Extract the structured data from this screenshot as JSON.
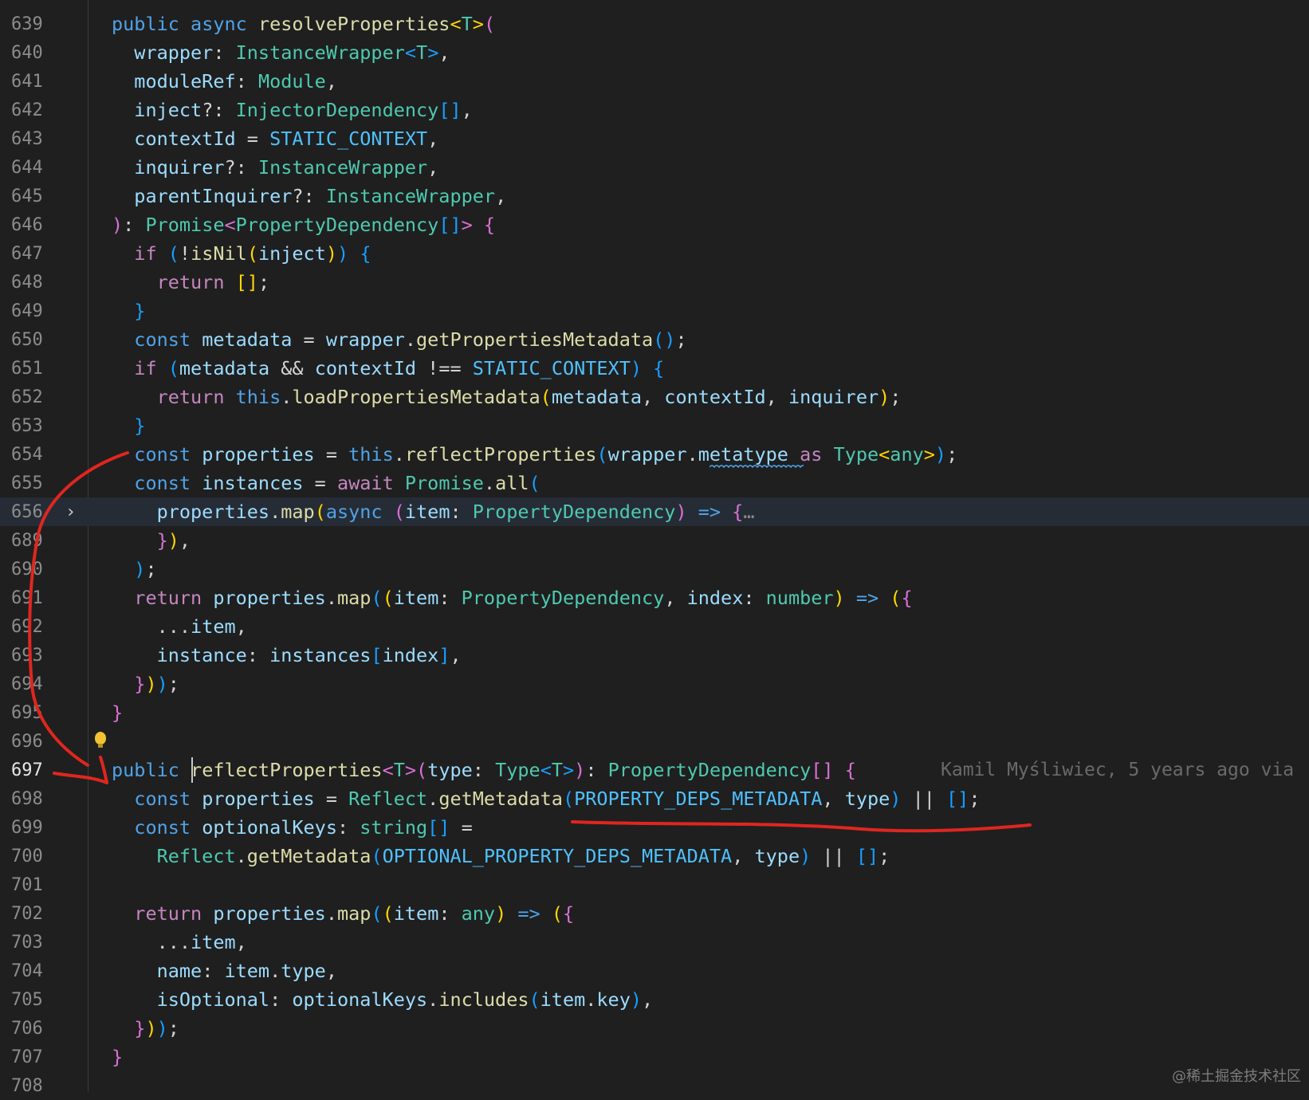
{
  "editor": {
    "lines": [
      {
        "num": "639",
        "tokens": [
          [
            "public ",
            "tok-key"
          ],
          [
            "async ",
            "tok-key"
          ],
          [
            "resolveProperties",
            "tok-fn"
          ],
          [
            "<",
            "tok-b1"
          ],
          [
            "T",
            "tok-type"
          ],
          [
            ">",
            "tok-b1"
          ],
          [
            "(",
            "tok-b2"
          ]
        ]
      },
      {
        "num": "640",
        "tokens": [
          [
            "  wrapper",
            "tok-var"
          ],
          [
            ": ",
            "tok-punc"
          ],
          [
            "InstanceWrapper",
            "tok-type"
          ],
          [
            "<",
            "tok-b3"
          ],
          [
            "T",
            "tok-type"
          ],
          [
            ">",
            "tok-b3"
          ],
          [
            ",",
            "tok-punc"
          ]
        ]
      },
      {
        "num": "641",
        "tokens": [
          [
            "  moduleRef",
            "tok-var"
          ],
          [
            ": ",
            "tok-punc"
          ],
          [
            "Module",
            "tok-type"
          ],
          [
            ",",
            "tok-punc"
          ]
        ]
      },
      {
        "num": "642",
        "tokens": [
          [
            "  inject",
            "tok-var"
          ],
          [
            "?: ",
            "tok-punc"
          ],
          [
            "InjectorDependency",
            "tok-type"
          ],
          [
            "[]",
            "tok-b3"
          ],
          [
            ",",
            "tok-punc"
          ]
        ]
      },
      {
        "num": "643",
        "tokens": [
          [
            "  contextId",
            "tok-var"
          ],
          [
            " = ",
            "tok-punc"
          ],
          [
            "STATIC_CONTEXT",
            "tok-const"
          ],
          [
            ",",
            "tok-punc"
          ]
        ]
      },
      {
        "num": "644",
        "tokens": [
          [
            "  inquirer",
            "tok-var"
          ],
          [
            "?: ",
            "tok-punc"
          ],
          [
            "InstanceWrapper",
            "tok-type"
          ],
          [
            ",",
            "tok-punc"
          ]
        ]
      },
      {
        "num": "645",
        "tokens": [
          [
            "  parentInquirer",
            "tok-var"
          ],
          [
            "?: ",
            "tok-punc"
          ],
          [
            "InstanceWrapper",
            "tok-type"
          ],
          [
            ",",
            "tok-punc"
          ]
        ]
      },
      {
        "num": "646",
        "tokens": [
          [
            ")",
            "tok-b2"
          ],
          [
            ": ",
            "tok-punc"
          ],
          [
            "Promise",
            "tok-type"
          ],
          [
            "<",
            "tok-b2"
          ],
          [
            "PropertyDependency",
            "tok-type"
          ],
          [
            "[]",
            "tok-b3"
          ],
          [
            ">",
            "tok-b2"
          ],
          [
            " {",
            "tok-b2"
          ]
        ]
      },
      {
        "num": "647",
        "tokens": [
          [
            "  if ",
            "tok-kw"
          ],
          [
            "(",
            "tok-b3"
          ],
          [
            "!",
            "tok-punc"
          ],
          [
            "isNil",
            "tok-fn"
          ],
          [
            "(",
            "tok-b1"
          ],
          [
            "inject",
            "tok-var"
          ],
          [
            ")",
            "tok-b1"
          ],
          [
            ")",
            "tok-b3"
          ],
          [
            " {",
            "tok-b3"
          ]
        ]
      },
      {
        "num": "648",
        "tokens": [
          [
            "    return ",
            "tok-kw"
          ],
          [
            "[]",
            "tok-b1"
          ],
          [
            ";",
            "tok-punc"
          ]
        ]
      },
      {
        "num": "649",
        "tokens": [
          [
            "  }",
            "tok-b3"
          ]
        ]
      },
      {
        "num": "650",
        "tokens": [
          [
            "  const ",
            "tok-key"
          ],
          [
            "metadata",
            "tok-var"
          ],
          [
            " = ",
            "tok-punc"
          ],
          [
            "wrapper",
            "tok-var"
          ],
          [
            ".",
            "tok-punc"
          ],
          [
            "getPropertiesMetadata",
            "tok-fn"
          ],
          [
            "()",
            "tok-b3"
          ],
          [
            ";",
            "tok-punc"
          ]
        ]
      },
      {
        "num": "651",
        "tokens": [
          [
            "  if ",
            "tok-kw"
          ],
          [
            "(",
            "tok-b3"
          ],
          [
            "metadata",
            "tok-var"
          ],
          [
            " && ",
            "tok-punc"
          ],
          [
            "contextId",
            "tok-var"
          ],
          [
            " !== ",
            "tok-punc"
          ],
          [
            "STATIC_CONTEXT",
            "tok-const"
          ],
          [
            ")",
            "tok-b3"
          ],
          [
            " {",
            "tok-b3"
          ]
        ]
      },
      {
        "num": "652",
        "tokens": [
          [
            "    return ",
            "tok-kw"
          ],
          [
            "this",
            "tok-key"
          ],
          [
            ".",
            "tok-punc"
          ],
          [
            "loadPropertiesMetadata",
            "tok-fn"
          ],
          [
            "(",
            "tok-b1"
          ],
          [
            "metadata",
            "tok-var"
          ],
          [
            ", ",
            "tok-punc"
          ],
          [
            "contextId",
            "tok-var"
          ],
          [
            ", ",
            "tok-punc"
          ],
          [
            "inquirer",
            "tok-var"
          ],
          [
            ")",
            "tok-b1"
          ],
          [
            ";",
            "tok-punc"
          ]
        ]
      },
      {
        "num": "653",
        "tokens": [
          [
            "  }",
            "tok-b3"
          ]
        ]
      },
      {
        "num": "654",
        "tokens": [
          [
            "  const ",
            "tok-key"
          ],
          [
            "properties",
            "tok-var"
          ],
          [
            " = ",
            "tok-punc"
          ],
          [
            "this",
            "tok-key"
          ],
          [
            ".",
            "tok-punc"
          ],
          [
            "reflectProperties",
            "tok-fn"
          ],
          [
            "(",
            "tok-b3"
          ],
          [
            "wrapper",
            "tok-var"
          ],
          [
            ".",
            "tok-punc"
          ],
          [
            "metatype",
            "tok-var"
          ],
          [
            " as ",
            "tok-kw"
          ],
          [
            "Type",
            "tok-type"
          ],
          [
            "<",
            "tok-b1"
          ],
          [
            "any",
            "tok-type"
          ],
          [
            ">",
            "tok-b1"
          ],
          [
            ")",
            "tok-b3"
          ],
          [
            ";",
            "tok-punc"
          ]
        ]
      },
      {
        "num": "655",
        "tokens": [
          [
            "  const ",
            "tok-key"
          ],
          [
            "instances",
            "tok-var"
          ],
          [
            " = ",
            "tok-punc"
          ],
          [
            "await ",
            "tok-kw"
          ],
          [
            "Promise",
            "tok-type"
          ],
          [
            ".",
            "tok-punc"
          ],
          [
            "all",
            "tok-fn"
          ],
          [
            "(",
            "tok-b3"
          ]
        ]
      },
      {
        "num": "656",
        "tokens": [
          [
            "    properties",
            "tok-var"
          ],
          [
            ".",
            "tok-punc"
          ],
          [
            "map",
            "tok-fn"
          ],
          [
            "(",
            "tok-b1"
          ],
          [
            "async ",
            "tok-key"
          ],
          [
            "(",
            "tok-b2"
          ],
          [
            "item",
            "tok-var"
          ],
          [
            ": ",
            "tok-punc"
          ],
          [
            "PropertyDependency",
            "tok-type"
          ],
          [
            ")",
            "tok-b2"
          ],
          [
            " => ",
            "tok-key"
          ],
          [
            "{",
            "tok-b2"
          ],
          [
            "…",
            "fold-dots"
          ]
        ]
      },
      {
        "num": "689",
        "tokens": [
          [
            "    }",
            "tok-b2"
          ],
          [
            ")",
            "tok-b1"
          ],
          [
            ",",
            "tok-punc"
          ]
        ]
      },
      {
        "num": "690",
        "tokens": [
          [
            "  )",
            "tok-b3"
          ],
          [
            ";",
            "tok-punc"
          ]
        ]
      },
      {
        "num": "691",
        "tokens": [
          [
            "  return ",
            "tok-kw"
          ],
          [
            "properties",
            "tok-var"
          ],
          [
            ".",
            "tok-punc"
          ],
          [
            "map",
            "tok-fn"
          ],
          [
            "(",
            "tok-b3"
          ],
          [
            "(",
            "tok-b1"
          ],
          [
            "item",
            "tok-var"
          ],
          [
            ": ",
            "tok-punc"
          ],
          [
            "PropertyDependency",
            "tok-type"
          ],
          [
            ", ",
            "tok-punc"
          ],
          [
            "index",
            "tok-var"
          ],
          [
            ": ",
            "tok-punc"
          ],
          [
            "number",
            "tok-type"
          ],
          [
            ")",
            "tok-b1"
          ],
          [
            " => ",
            "tok-key"
          ],
          [
            "(",
            "tok-b1"
          ],
          [
            "{",
            "tok-b2"
          ]
        ]
      },
      {
        "num": "692",
        "tokens": [
          [
            "    ...",
            "tok-punc"
          ],
          [
            "item",
            "tok-var"
          ],
          [
            ",",
            "tok-punc"
          ]
        ]
      },
      {
        "num": "693",
        "tokens": [
          [
            "    instance",
            "tok-var"
          ],
          [
            ": ",
            "tok-punc"
          ],
          [
            "instances",
            "tok-var"
          ],
          [
            "[",
            "tok-b3"
          ],
          [
            "index",
            "tok-var"
          ],
          [
            "]",
            "tok-b3"
          ],
          [
            ",",
            "tok-punc"
          ]
        ]
      },
      {
        "num": "694",
        "tokens": [
          [
            "  }",
            "tok-b2"
          ],
          [
            ")",
            "tok-b1"
          ],
          [
            ")",
            "tok-b3"
          ],
          [
            ";",
            "tok-punc"
          ]
        ]
      },
      {
        "num": "695",
        "tokens": [
          [
            "}",
            "tok-b2"
          ]
        ]
      },
      {
        "num": "696",
        "tokens": []
      },
      {
        "num": "697",
        "tokens": [
          [
            "public ",
            "tok-key"
          ],
          [
            "reflectProperties",
            "tok-fn"
          ],
          [
            "<",
            "tok-b2"
          ],
          [
            "T",
            "tok-type"
          ],
          [
            ">",
            "tok-b2"
          ],
          [
            "(",
            "tok-b2"
          ],
          [
            "type",
            "tok-var"
          ],
          [
            ": ",
            "tok-punc"
          ],
          [
            "Type",
            "tok-type"
          ],
          [
            "<",
            "tok-b3"
          ],
          [
            "T",
            "tok-type"
          ],
          [
            ">",
            "tok-b3"
          ],
          [
            ")",
            "tok-b2"
          ],
          [
            ": ",
            "tok-punc"
          ],
          [
            "PropertyDependency",
            "tok-type"
          ],
          [
            "[]",
            "tok-b2"
          ],
          [
            " {",
            "tok-b2"
          ]
        ],
        "blame": "Kamil Myśliwiec, 5 years ago via"
      },
      {
        "num": "698",
        "tokens": [
          [
            "  const ",
            "tok-key"
          ],
          [
            "properties",
            "tok-var"
          ],
          [
            " = ",
            "tok-punc"
          ],
          [
            "Reflect",
            "tok-type"
          ],
          [
            ".",
            "tok-punc"
          ],
          [
            "getMetadata",
            "tok-fn"
          ],
          [
            "(",
            "tok-b3"
          ],
          [
            "PROPERTY_DEPS_METADATA",
            "tok-const"
          ],
          [
            ", ",
            "tok-punc"
          ],
          [
            "type",
            "tok-var"
          ],
          [
            ")",
            "tok-b3"
          ],
          [
            " || ",
            "tok-punc"
          ],
          [
            "[]",
            "tok-b3"
          ],
          [
            ";",
            "tok-punc"
          ]
        ]
      },
      {
        "num": "699",
        "tokens": [
          [
            "  const ",
            "tok-key"
          ],
          [
            "optionalKeys",
            "tok-var"
          ],
          [
            ": ",
            "tok-punc"
          ],
          [
            "string",
            "tok-type"
          ],
          [
            "[]",
            "tok-b3"
          ],
          [
            " =",
            "tok-punc"
          ]
        ]
      },
      {
        "num": "700",
        "tokens": [
          [
            "    Reflect",
            "tok-type"
          ],
          [
            ".",
            "tok-punc"
          ],
          [
            "getMetadata",
            "tok-fn"
          ],
          [
            "(",
            "tok-b3"
          ],
          [
            "OPTIONAL_PROPERTY_DEPS_METADATA",
            "tok-const"
          ],
          [
            ", ",
            "tok-punc"
          ],
          [
            "type",
            "tok-var"
          ],
          [
            ")",
            "tok-b3"
          ],
          [
            " || ",
            "tok-punc"
          ],
          [
            "[]",
            "tok-b3"
          ],
          [
            ";",
            "tok-punc"
          ]
        ]
      },
      {
        "num": "701",
        "tokens": []
      },
      {
        "num": "702",
        "tokens": [
          [
            "  return ",
            "tok-kw"
          ],
          [
            "properties",
            "tok-var"
          ],
          [
            ".",
            "tok-punc"
          ],
          [
            "map",
            "tok-fn"
          ],
          [
            "(",
            "tok-b3"
          ],
          [
            "(",
            "tok-b1"
          ],
          [
            "item",
            "tok-var"
          ],
          [
            ": ",
            "tok-punc"
          ],
          [
            "any",
            "tok-type"
          ],
          [
            ")",
            "tok-b1"
          ],
          [
            " => ",
            "tok-key"
          ],
          [
            "(",
            "tok-b1"
          ],
          [
            "{",
            "tok-b2"
          ]
        ]
      },
      {
        "num": "703",
        "tokens": [
          [
            "    ...",
            "tok-punc"
          ],
          [
            "item",
            "tok-var"
          ],
          [
            ",",
            "tok-punc"
          ]
        ]
      },
      {
        "num": "704",
        "tokens": [
          [
            "    name",
            "tok-var"
          ],
          [
            ": ",
            "tok-punc"
          ],
          [
            "item",
            "tok-var"
          ],
          [
            ".",
            "tok-punc"
          ],
          [
            "type",
            "tok-var"
          ],
          [
            ",",
            "tok-punc"
          ]
        ]
      },
      {
        "num": "705",
        "tokens": [
          [
            "    isOptional",
            "tok-var"
          ],
          [
            ": ",
            "tok-punc"
          ],
          [
            "optionalKeys",
            "tok-var"
          ],
          [
            ".",
            "tok-punc"
          ],
          [
            "includes",
            "tok-fn"
          ],
          [
            "(",
            "tok-b3"
          ],
          [
            "item",
            "tok-var"
          ],
          [
            ".",
            "tok-punc"
          ],
          [
            "key",
            "tok-var"
          ],
          [
            ")",
            "tok-b3"
          ],
          [
            ",",
            "tok-punc"
          ]
        ]
      },
      {
        "num": "706",
        "tokens": [
          [
            "  }",
            "tok-b2"
          ],
          [
            ")",
            "tok-b1"
          ],
          [
            ")",
            "tok-b3"
          ],
          [
            ";",
            "tok-punc"
          ]
        ]
      },
      {
        "num": "707",
        "tokens": [
          [
            "}",
            "tok-b2"
          ]
        ]
      },
      {
        "num": "708",
        "tokens": []
      }
    ]
  },
  "colors": {
    "background": "#1f1f1f",
    "highlight_row": "#262c36",
    "annotation_red": "#e0261f"
  },
  "icons": {
    "fold": "chevron-right-icon",
    "lightbulb": "lightbulb-icon"
  },
  "watermark": "@稀土掘金技术社区"
}
